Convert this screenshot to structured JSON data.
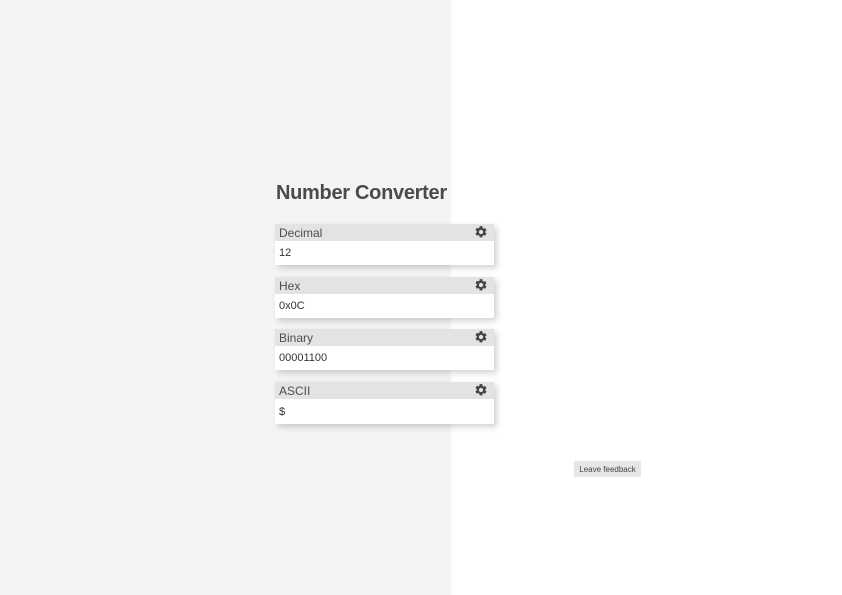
{
  "app": {
    "title": "Number Converter"
  },
  "converters": [
    {
      "label": "Decimal",
      "value": "12",
      "icon": "gear-icon"
    },
    {
      "label": "Hex",
      "value": "0x0C",
      "icon": "gear-icon"
    },
    {
      "label": "Binary",
      "value": "00001100",
      "icon": "gear-icon"
    },
    {
      "label": "ASCII",
      "value": "$",
      "icon": "gear-icon"
    }
  ],
  "feedback": {
    "label": "Leave feedback"
  },
  "colors": {
    "left_panel_bg": "#f4f4f4",
    "card_header_bg": "#e3e3e3",
    "title_text": "#4a4a4a",
    "icon": "#444444"
  }
}
